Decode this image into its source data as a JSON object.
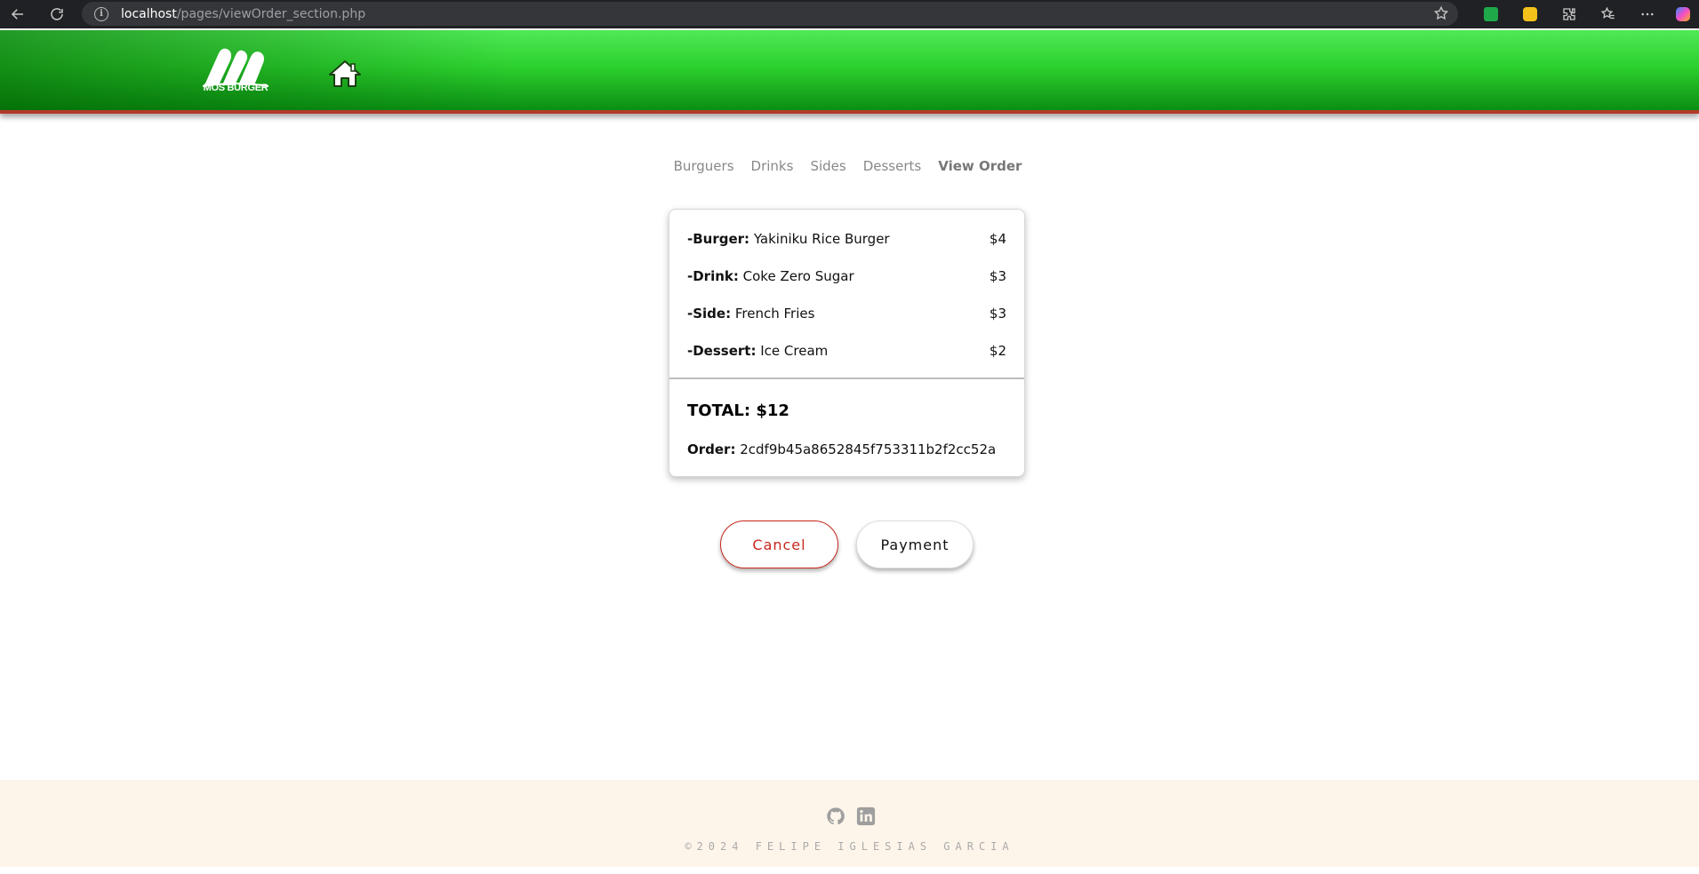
{
  "browser": {
    "url_host": "localhost",
    "url_path": "/pages/viewOrder_section.php"
  },
  "header": {
    "logo_text": "MOS BURGER"
  },
  "section_nav": [
    {
      "label": "Burguers",
      "active": false
    },
    {
      "label": "Drinks",
      "active": false
    },
    {
      "label": "Sides",
      "active": false
    },
    {
      "label": "Desserts",
      "active": false
    },
    {
      "label": "View Order",
      "active": true
    }
  ],
  "order": {
    "items": [
      {
        "category": "-Burger:",
        "name": "Yakiniku Rice Burger",
        "price": "$4"
      },
      {
        "category": "-Drink:",
        "name": "Coke Zero Sugar",
        "price": "$3"
      },
      {
        "category": "-Side:",
        "name": "French Fries",
        "price": "$3"
      },
      {
        "category": "-Dessert:",
        "name": "Ice Cream",
        "price": "$2"
      }
    ],
    "total": "TOTAL: $12",
    "order_label": "Order:",
    "order_id": "2cdf9b45a8652845f753311b2f2cc52a"
  },
  "buttons": {
    "cancel": "Cancel",
    "payment": "Payment"
  },
  "footer": {
    "copyright": "©2024 FELIPE IGLESIAS GARCIA",
    "icons": [
      "github-icon",
      "linkedin-icon"
    ]
  },
  "colors": {
    "header_green": "#2dd12f",
    "header_border": "#b43a2a",
    "cancel_red": "#c8281e",
    "footer_bg": "#fdf5ea"
  }
}
